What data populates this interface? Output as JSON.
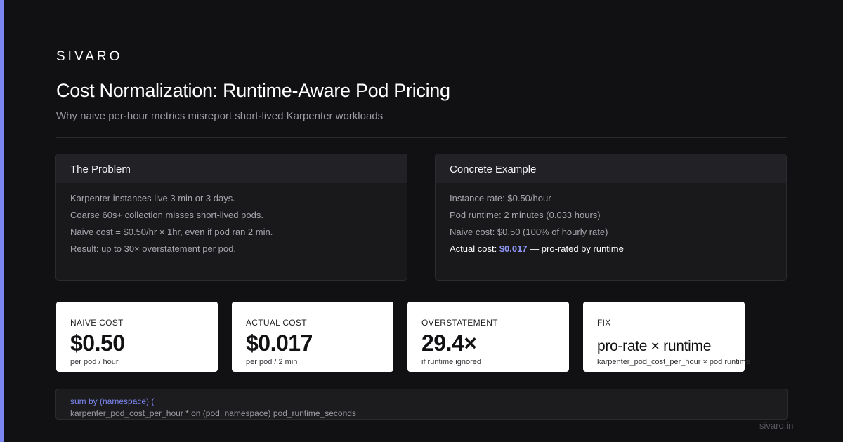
{
  "brand": "SIVARO",
  "title": "Cost Normalization: Runtime-Aware Pod Pricing",
  "subtitle": "Why naive per-hour metrics misreport short-lived Karpenter workloads",
  "colors": {
    "accent": "#7c86f0",
    "background": "#111113",
    "highlight": "#8e96f5"
  },
  "problem": {
    "heading": "The Problem",
    "lines": [
      "Karpenter instances live 3 min or 3 days.",
      "Coarse 60s+ collection misses short-lived pods.",
      "Naive cost = $0.50/hr × 1hr, even if pod ran 2 min.",
      "Result: up to 30× overstatement per pod."
    ]
  },
  "example": {
    "heading": "Concrete Example",
    "lines": [
      "Instance rate: $0.50/hour",
      "Pod runtime: 2 minutes (0.033 hours)",
      "Naive cost: $0.50 (100% of hourly rate)"
    ],
    "actual_prefix": "Actual cost: ",
    "actual_value": "$0.017",
    "actual_suffix": " — pro-rated by runtime"
  },
  "stats": [
    {
      "label": "NAIVE COST",
      "value": "$0.50",
      "caption": "per pod / hour"
    },
    {
      "label": "ACTUAL COST",
      "value": "$0.017",
      "caption": "per pod / 2 min"
    },
    {
      "label": "OVERSTATEMENT",
      "value": "29.4×",
      "caption": "if runtime ignored"
    },
    {
      "label": "FIX",
      "value": "pro-rate × runtime",
      "caption": "karpenter_pod_cost_per_hour × pod runtime"
    }
  ],
  "code": {
    "line1": "sum by (namespace) (",
    "line2": "karpenter_pod_cost_per_hour * on (pod, namespace) pod_runtime_seconds"
  },
  "footer": "sivaro.in"
}
